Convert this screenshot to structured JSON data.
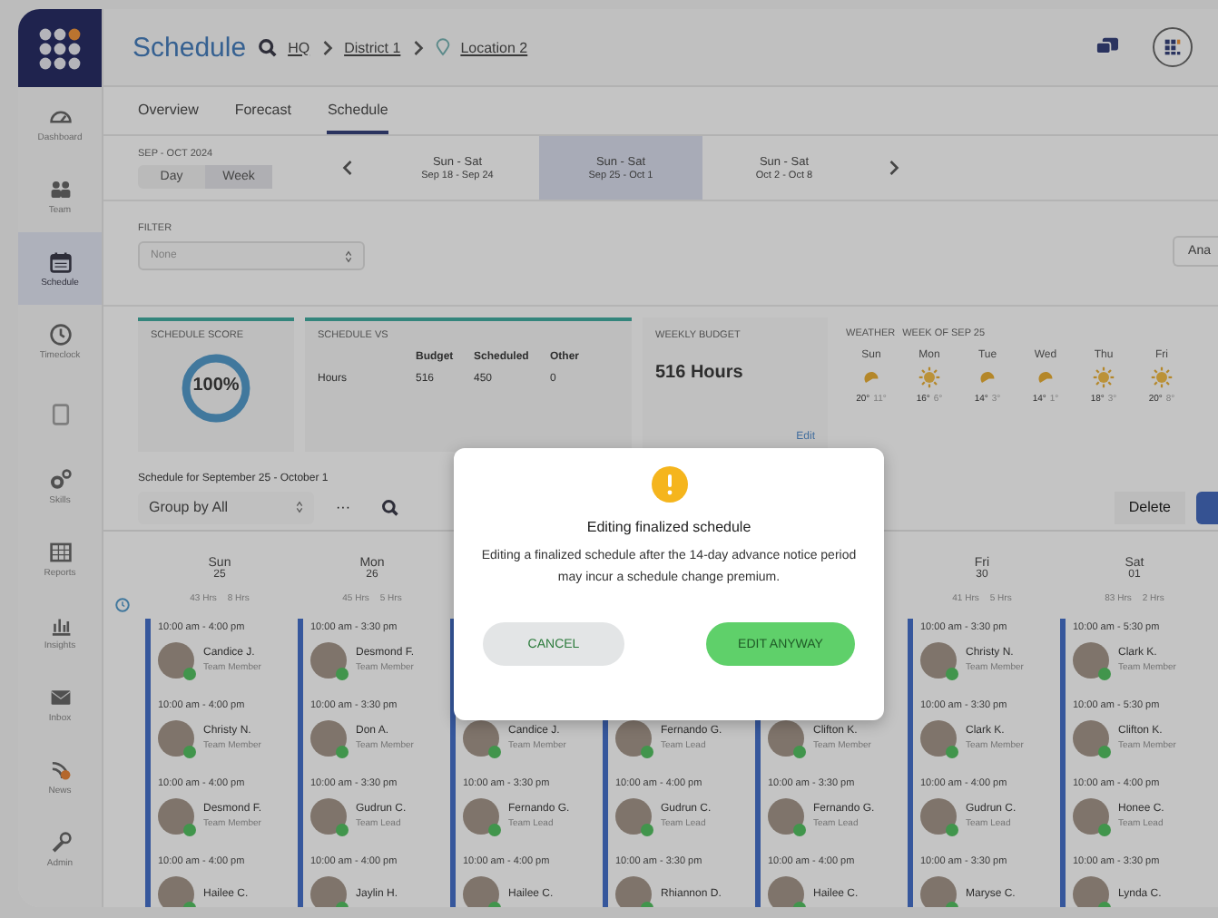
{
  "sidebar": {
    "items": [
      {
        "label": "Dashboard",
        "kind": "dashboard",
        "selected": false
      },
      {
        "label": "Team",
        "kind": "team",
        "selected": false
      },
      {
        "label": "Schedule",
        "kind": "calendar",
        "selected": true
      },
      {
        "label": "Timeclock",
        "kind": "clock",
        "selected": false
      },
      {
        "kind": "document",
        "selected": false
      },
      {
        "label": "Skills",
        "kind": "gears",
        "selected": false
      },
      {
        "label": "Reports",
        "kind": "table",
        "selected": false
      },
      {
        "label": "Insights",
        "kind": "chart",
        "selected": false
      },
      {
        "label": "Inbox",
        "kind": "mail",
        "selected": false
      },
      {
        "label": "News",
        "kind": "feed",
        "selected": false
      },
      {
        "label": "Admin",
        "kind": "wrench",
        "selected": false
      }
    ]
  },
  "header": {
    "title": "Schedule",
    "breadcrumbs": [
      "HQ",
      "District 1",
      "Location 2"
    ]
  },
  "tabs": [
    {
      "label": "Overview",
      "selected": false
    },
    {
      "label": "Forecast",
      "selected": false
    },
    {
      "label": "Schedule",
      "selected": true
    }
  ],
  "period": {
    "label": "SEP - OCT 2024",
    "modes": [
      {
        "label": "Day",
        "selected": false
      },
      {
        "label": "Week",
        "selected": true
      }
    ],
    "weeks": [
      {
        "days": "Sun - Sat",
        "range": "Sep 18 - Sep 24",
        "selected": false
      },
      {
        "days": "Sun - Sat",
        "range": "Sep 25 - Oct 1",
        "selected": true
      },
      {
        "days": "Sun - Sat",
        "range": "Oct 2 - Oct 8",
        "selected": false
      }
    ]
  },
  "filter": {
    "label": "FILTER",
    "placeholder": "None"
  },
  "analytics_button": "Ana",
  "score": {
    "title": "SCHEDULE SCORE",
    "value": "100%",
    "level": 1
  },
  "comparison": {
    "title": "SCHEDULE VS",
    "columns": [
      "Budget",
      "Scheduled",
      "Other"
    ],
    "row": {
      "label": "Hours",
      "values": [
        "516",
        "450",
        "0"
      ]
    }
  },
  "budget": {
    "title": "WEEKLY BUDGET",
    "value": "516 Hours",
    "edit": "Edit"
  },
  "weather": {
    "title": "WEATHER",
    "subtitle": "WEEK OF SEP 25",
    "days": [
      {
        "day": "Sun",
        "kind": "partly",
        "high": "20°",
        "low": "11°"
      },
      {
        "day": "Mon",
        "kind": "sun",
        "high": "16°",
        "low": "6°"
      },
      {
        "day": "Tue",
        "kind": "partly",
        "high": "14°",
        "low": "3°"
      },
      {
        "day": "Wed",
        "kind": "partly",
        "high": "14°",
        "low": "1°"
      },
      {
        "day": "Thu",
        "kind": "sun",
        "high": "18°",
        "low": "3°"
      },
      {
        "day": "Fri",
        "kind": "sun",
        "high": "20°",
        "low": "8°"
      }
    ]
  },
  "schedule_title": "Schedule for September 25 - October 1",
  "group_by": "Group by All",
  "more": "···",
  "delete": "Delete",
  "days": [
    {
      "day": "Sun",
      "date": "25",
      "hours": "43 Hrs",
      "extra": "8 Hrs",
      "shifts": [
        {
          "time": "10:00 am - 4:00 pm",
          "name": "Candice J.",
          "role": "Team Member"
        },
        {
          "time": "10:00 am - 4:00 pm",
          "name": "Christy N.",
          "role": "Team Member"
        },
        {
          "time": "10:00 am - 4:00 pm",
          "name": "Desmond F.",
          "role": "Team Member"
        },
        {
          "time": "10:00 am - 4:00 pm",
          "name": "Hailee C."
        }
      ]
    },
    {
      "day": "Mon",
      "date": "26",
      "hours": "45 Hrs",
      "extra": "5 Hrs",
      "shifts": [
        {
          "time": "10:00 am - 3:30 pm",
          "name": "Desmond F.",
          "role": "Team Member"
        },
        {
          "time": "10:00 am - 3:30 pm",
          "name": "Don A.",
          "role": "Team Member"
        },
        {
          "time": "10:00 am - 3:30 pm",
          "name": "Gudrun C.",
          "role": "Team Lead"
        },
        {
          "time": "10:00 am - 4:00 pm",
          "name": "Jaylin H."
        }
      ]
    },
    {
      "shifts": [
        {
          "name": "Candice J.",
          "role": "Team Member"
        },
        {
          "time": "10:00 am - 3:30 pm",
          "name": "Fernando G.",
          "role": "Team Lead"
        },
        {
          "time": "10:00 am - 4:00 pm",
          "name": "Hailee C."
        }
      ]
    },
    {
      "shifts": [
        {
          "name": "Fernando G.",
          "role": "Team Lead"
        },
        {
          "time": "10:00 am - 4:00 pm",
          "name": "Gudrun C.",
          "role": "Team Lead"
        },
        {
          "time": "10:00 am - 3:30 pm",
          "name": "Rhiannon D."
        }
      ]
    },
    {
      "shifts": [
        {
          "name": "Clifton K.",
          "role": "Team Member"
        },
        {
          "time": "10:00 am - 3:30 pm",
          "name": "Fernando G.",
          "role": "Team Lead"
        },
        {
          "time": "10:00 am - 4:00 pm",
          "name": "Hailee C."
        }
      ]
    },
    {
      "day": "Fri",
      "date": "30",
      "hours": "41 Hrs",
      "extra": "5 Hrs",
      "shifts": [
        {
          "time": "10:00 am - 3:30 pm",
          "name": "Christy N.",
          "role": "Team Member"
        },
        {
          "time": "10:00 am - 3:30 pm",
          "name": "Clark K.",
          "role": "Team Member"
        },
        {
          "time": "10:00 am - 4:00 pm",
          "name": "Gudrun C.",
          "role": "Team Lead"
        },
        {
          "time": "10:00 am - 3:30 pm",
          "name": "Maryse C."
        }
      ]
    },
    {
      "day": "Sat",
      "date": "01",
      "hours": "83 Hrs",
      "extra": "2 Hrs",
      "shifts": [
        {
          "time": "10:00 am - 5:30 pm",
          "name": "Clark K.",
          "role": "Team Member"
        },
        {
          "time": "10:00 am - 5:30 pm",
          "name": "Clifton K.",
          "role": "Team Member"
        },
        {
          "time": "10:00 am - 4:00 pm",
          "name": "Honee C.",
          "role": "Team Lead"
        },
        {
          "time": "10:00 am - 3:30 pm",
          "name": "Lynda C."
        }
      ]
    }
  ],
  "dialog": {
    "title": "Editing finalized schedule",
    "message": "Editing a finalized schedule after the 14-day advance notice period may incur a schedule change premium.",
    "cancel": "CANCEL",
    "confirm": "EDIT ANYWAY"
  }
}
